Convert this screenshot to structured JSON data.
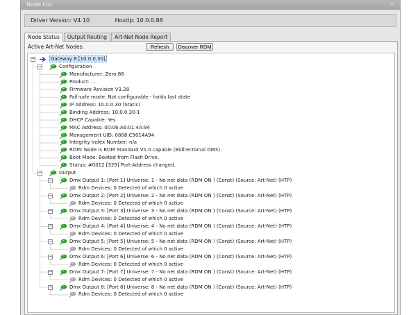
{
  "window": {
    "title": "Node List"
  },
  "info": {
    "driver_version": "Driver Version: V4.10",
    "host_ip": "HostIp: 10.0.0.88"
  },
  "tabs": [
    {
      "label": "Node Status",
      "active": true
    },
    {
      "label": "Output Routing",
      "active": false
    },
    {
      "label": "Art-Net Node Report",
      "active": false
    }
  ],
  "toolbar": {
    "label": "Active Art-Net Nodes:",
    "refresh_label": "Refresh",
    "discover_label": "Discover RDM"
  },
  "colors": {
    "green_icon": "#2aa02a",
    "gray_icon": "#a9a9a9",
    "arrow_icon": "#1f54b8"
  },
  "tree": [
    {
      "text": "Gateway 8 [10.0.0.30]",
      "level": 0,
      "icon": "arrow",
      "expander": "minus",
      "selected": true
    },
    {
      "text": "Configuration",
      "level": 1,
      "icon": "green",
      "expander": "minus"
    },
    {
      "text": "Manufacturer: Zero 88",
      "level": 2,
      "icon": "green"
    },
    {
      "text": "Product: ...",
      "level": 2,
      "icon": "green"
    },
    {
      "text": "Firmware Revision V3.28",
      "level": 2,
      "icon": "green"
    },
    {
      "text": "Fail-safe mode: Not configurable - holds last state",
      "level": 2,
      "icon": "green"
    },
    {
      "text": "IP Address: 10.0.0.30 (Static)",
      "level": 2,
      "icon": "green"
    },
    {
      "text": "Binding Address: 10.0.0.30-1",
      "level": 2,
      "icon": "green"
    },
    {
      "text": "DHCP Capable: Yes",
      "level": 2,
      "icon": "green"
    },
    {
      "text": "MAC Address: 00:06:A6:01:4A:94",
      "level": 2,
      "icon": "green"
    },
    {
      "text": "Management UID: 0808:C9014A94",
      "level": 2,
      "icon": "green"
    },
    {
      "text": "Integrity Index Number: n/a",
      "level": 2,
      "icon": "green"
    },
    {
      "text": "RDM: Node is RDM Standard V1.0 capable (Bidirectional DMX).",
      "level": 2,
      "icon": "green"
    },
    {
      "text": "Boot Mode: Booted from Flash Drive.",
      "level": 2,
      "icon": "green"
    },
    {
      "text": "Status: #0012 [329] Port-Address changed.",
      "level": 2,
      "icon": "green"
    },
    {
      "text": "Output",
      "level": 1,
      "icon": "green",
      "expander": "minus"
    },
    {
      "text": "Dmx Output 1: [Port 1] Universe: 1  - No net data (RDM ON ) (Const) (Source: Art-Net) (HTP)",
      "level": 2,
      "icon": "green",
      "expander": "minus"
    },
    {
      "text": "Rdm Devices: 0 Detected of which 0 active",
      "level": 3,
      "icon": "gray"
    },
    {
      "text": "Dmx Output 2: [Port 2] Universe: 2  - No net data (RDM ON ) (Const) (Source: Art-Net) (HTP)",
      "level": 2,
      "icon": "green",
      "expander": "minus"
    },
    {
      "text": "Rdm Devices: 0 Detected of which 0 active",
      "level": 3,
      "icon": "gray"
    },
    {
      "text": "Dmx Output 3: [Port 3] Universe: 3  - No net data (RDM ON ) (Const) (Source: Art-Net) (HTP)",
      "level": 2,
      "icon": "green",
      "expander": "minus"
    },
    {
      "text": "Rdm Devices: 0 Detected of which 0 active",
      "level": 3,
      "icon": "gray"
    },
    {
      "text": "Dmx Output 4: [Port 4] Universe: 4  - No net data (RDM ON ) (Const) (Source: Art-Net) (HTP)",
      "level": 2,
      "icon": "green",
      "expander": "minus"
    },
    {
      "text": "Rdm Devices: 0 Detected of which 0 active",
      "level": 3,
      "icon": "gray"
    },
    {
      "text": "Dmx Output 5: [Port 5] Universe: 5  - No net data (RDM ON ) (Const) (Source: Art-Net) (HTP)",
      "level": 2,
      "icon": "green",
      "expander": "minus"
    },
    {
      "text": "Rdm Devices: 0 Detected of which 0 active",
      "level": 3,
      "icon": "gray"
    },
    {
      "text": "Dmx Output 6: [Port 6] Universe: 6  - No net data (RDM ON ) (Const) (Source: Art-Net) (HTP)",
      "level": 2,
      "icon": "green",
      "expander": "minus"
    },
    {
      "text": "Rdm Devices: 0 Detected of which 0 active",
      "level": 3,
      "icon": "gray"
    },
    {
      "text": "Dmx Output 7: [Port 7] Universe: 7  - No net data (RDM ON ) (Const) (Source: Art-Net) (HTP)",
      "level": 2,
      "icon": "green",
      "expander": "minus"
    },
    {
      "text": "Rdm Devices: 0 Detected of which 0 active",
      "level": 3,
      "icon": "gray"
    },
    {
      "text": "Dmx Output 8: [Port 8] Universe: 8  - No net data (RDM ON ) (Const) (Source: Art-Net) (HTP)",
      "level": 2,
      "icon": "green",
      "expander": "minus"
    },
    {
      "text": "Rdm Devices: 0 Detected of which 0 active",
      "level": 3,
      "icon": "gray"
    }
  ]
}
